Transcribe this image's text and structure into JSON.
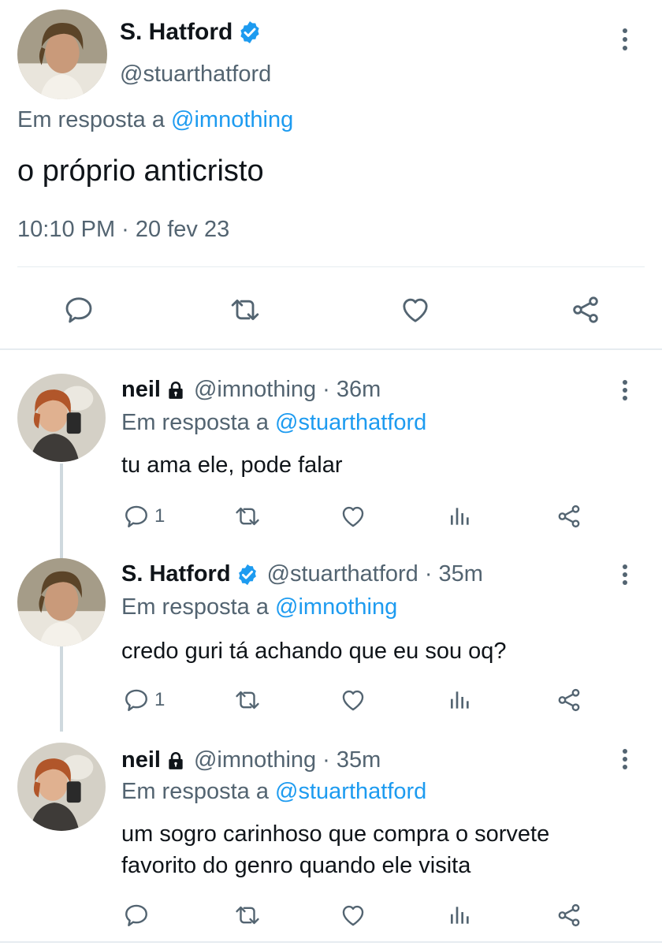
{
  "main_tweet": {
    "display_name": "S. Hatford",
    "handle": "@stuarthatford",
    "reply_prefix": "Em resposta a",
    "reply_to": "@imnothing",
    "text": "o próprio anticristo",
    "timestamp": "10:10 PM · 20 fev 23",
    "verified": true,
    "actions": [
      "reply-icon",
      "retweet-icon",
      "like-icon",
      "share-icon"
    ]
  },
  "replies": [
    {
      "display_name": "neil",
      "handle": "@imnothing",
      "time": "· 36m",
      "reply_prefix": "Em resposta a",
      "reply_to": "@stuarthatford",
      "text_lines": [
        "tu ama ele, pode falar"
      ],
      "reply_count": "1",
      "protected": true
    },
    {
      "display_name": "S. Hatford",
      "handle": "@stuarthatford",
      "time": "· 35m",
      "reply_prefix": "Em resposta a",
      "reply_to": "@imnothing",
      "text_lines": [
        "credo guri tá achando que eu sou oq?"
      ],
      "reply_count": "1",
      "verified": true
    },
    {
      "display_name": "neil",
      "handle": "@imnothing",
      "time": "· 35m",
      "reply_prefix": "Em resposta a",
      "reply_to": "@stuarthatford",
      "text_lines": [
        "um sogro carinhoso que compra o sorvete",
        "favorito do genro quando ele visita"
      ],
      "reply_count": "",
      "protected": true
    }
  ],
  "colors": {
    "accent": "#1d9bf0",
    "text": "#0f1419",
    "secondary": "#536471",
    "divider": "#e6ecf0",
    "thread_line": "#cfd9de"
  }
}
